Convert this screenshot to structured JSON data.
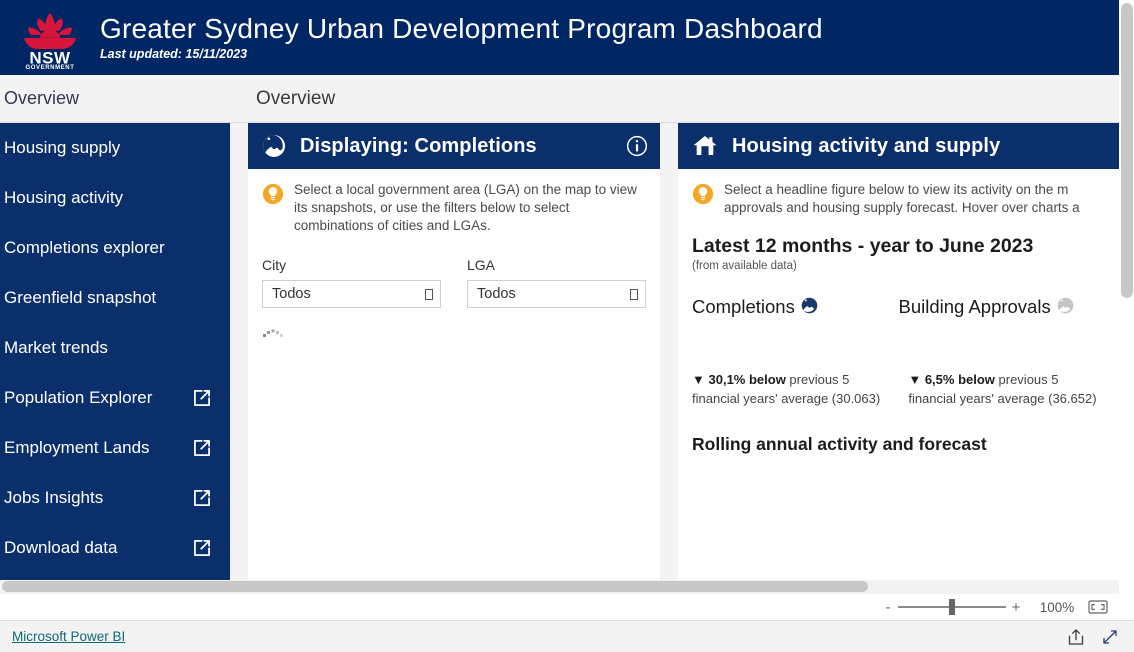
{
  "header": {
    "logo_icon": "nsw-waratah-logo",
    "logo_text_primary": "NSW",
    "logo_text_secondary": "GOVERNMENT",
    "title": "Greater Sydney Urban Development Program Dashboard",
    "last_updated": "Last updated: 15/11/2023",
    "navy": "#002664"
  },
  "breadcrumb": {
    "left_label": "Overview",
    "page_title": "Overview"
  },
  "sidebar": {
    "background": "#0b2f6b",
    "items": [
      {
        "label": "Housing supply",
        "external": false
      },
      {
        "label": "Housing activity",
        "external": false
      },
      {
        "label": "Completions explorer",
        "external": false
      },
      {
        "label": "Greenfield snapshot",
        "external": false
      },
      {
        "label": "Market trends",
        "external": false
      },
      {
        "label": "Population Explorer",
        "external": true
      },
      {
        "label": "Employment Lands",
        "external": true
      },
      {
        "label": "Jobs Insights",
        "external": true
      },
      {
        "label": "Download data",
        "external": true
      }
    ]
  },
  "left_card": {
    "header_icon": "globe-icon",
    "title": "Displaying: Completions",
    "info_icon": "info-circle-icon",
    "hint_icon": "lightbulb-icon",
    "hint": "Select a local government area (LGA) on the map to view its snapshots, or use the filters below to select combinations of cities and LGAs.",
    "filters": [
      {
        "label": "City",
        "value": "Todos"
      },
      {
        "label": "LGA",
        "value": "Todos"
      }
    ],
    "loading_icon": "loading-spinner-icon"
  },
  "right_card": {
    "header_icon": "house-icon",
    "title": "Housing activity and supply",
    "hint_icon": "lightbulb-icon",
    "hint_line1": "Select a headline figure below to view its activity on the m",
    "hint_line2": "approvals and housing supply forecast. Hover over charts a",
    "section_title": "Latest 12 months - year to June 2023",
    "section_subtitle": "(from available data)",
    "metrics": [
      {
        "name": "Completions",
        "globe_icon": "globe-icon-active",
        "globe_color": "#1a3a6b",
        "delta_arrow": "▼",
        "delta_value": "30,1% below",
        "delta_rest": " previous 5 financial years' average (30.063)"
      },
      {
        "name": "Building Approvals",
        "globe_icon": "globe-icon-inactive",
        "globe_color": "#c4c4c4",
        "delta_arrow": "▼",
        "delta_value": "6,5% below",
        "delta_rest": " previous 5 financial years' average (36.652)"
      }
    ],
    "chart_title": "Rolling annual activity and forecast"
  },
  "zoom_bar": {
    "minus_label": "-",
    "plus_label": "+",
    "percent": "100%",
    "fit_icon": "fit-to-page-icon"
  },
  "footer": {
    "link_label": "Microsoft Power BI",
    "link_color": "#0f6a72",
    "share_icon": "share-icon",
    "fullscreen_icon": "fullscreen-icon"
  },
  "scrollbars": {
    "vertical_icon": "vertical-scrollbar",
    "horizontal_icon": "horizontal-scrollbar"
  }
}
